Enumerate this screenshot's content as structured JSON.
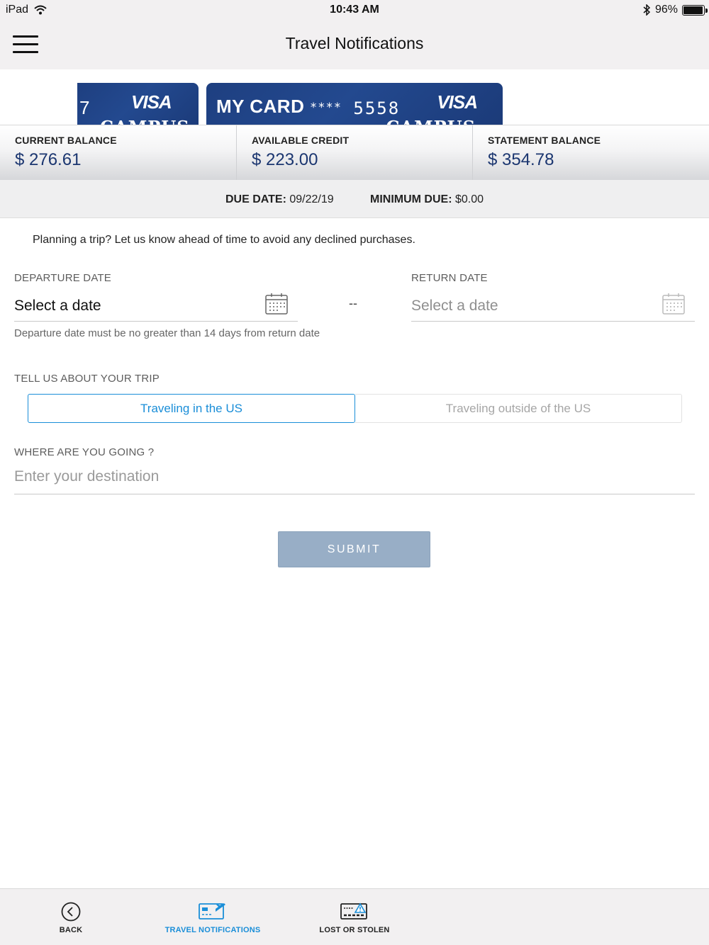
{
  "status_bar": {
    "device": "iPad",
    "time": "10:43 AM",
    "battery": "96%",
    "battery_level": 0.96
  },
  "header": {
    "title": "Travel Notifications"
  },
  "cards": {
    "left_fragment": "7",
    "brand": "VISA",
    "issuer": "CAMPUS",
    "main_name": "MY CARD",
    "main_mask": "****",
    "main_digits": "5558"
  },
  "balances": {
    "current_label": "CURRENT BALANCE",
    "current_value": "$ 276.61",
    "available_label": "AVAILABLE CREDIT",
    "available_value": "$ 223.00",
    "statement_label": "STATEMENT BALANCE",
    "statement_value": "$ 354.78"
  },
  "due": {
    "date_label": "DUE DATE:",
    "date_value": "09/22/19",
    "min_label": "MINIMUM DUE:",
    "min_value": "$0.00"
  },
  "form": {
    "intro": "Planning a trip? Let us know ahead of time to avoid any declined purchases.",
    "departure_label": "DEPARTURE DATE",
    "departure_value": "Select a date",
    "return_label": "RETURN DATE",
    "return_value": "Select a date",
    "separator": "--",
    "hint": "Departure date must be no greater than 14 days from return date",
    "trip_label": "TELL US ABOUT YOUR TRIP",
    "trip_options": [
      "Traveling in the US",
      "Traveling outside of the US"
    ],
    "trip_selected": "Traveling in the US",
    "destination_label": "WHERE ARE YOU GOING ?",
    "destination_placeholder": "Enter your destination",
    "destination_value": "",
    "submit_label": "SUBMIT"
  },
  "tabs": [
    {
      "label": "BACK",
      "icon": "back-arrow-circle-icon"
    },
    {
      "label": "TRAVEL NOTIFICATIONS",
      "icon": "card-airplane-icon",
      "active": true
    },
    {
      "label": "LOST OR STOLEN",
      "icon": "card-warning-icon"
    }
  ],
  "colors": {
    "accent": "#1a8ed8",
    "card_blue": "#23498f",
    "balance_text": "#1b3670",
    "submit_bg": "#98aec6"
  }
}
